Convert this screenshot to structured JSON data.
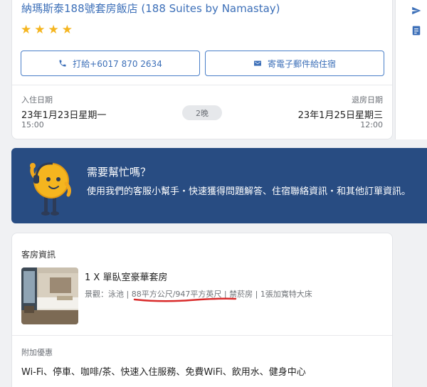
{
  "hotel": {
    "name": "納瑪斯泰188號套房飯店 (188 Suites by Namastay)",
    "star_count": 4,
    "stars": [
      "★",
      "★",
      "★",
      "★"
    ],
    "call_label": "打給+6017 870 2634",
    "email_label": "寄電子郵件給住宿",
    "checkin_label": "入住日期",
    "checkin_date": "23年1月23日星期一",
    "checkin_time": "15:00",
    "nights": "2晚",
    "checkout_label": "退房日期",
    "checkout_date": "23年1月25日星期三",
    "checkout_time": "12:00"
  },
  "help": {
    "title": "需要幫忙嗎？",
    "text": "使用我們的客服小幫手・快速獲得問題解答、住宿聯絡資訊・和其他訂單資訊。"
  },
  "room": {
    "section_title": "客房資訊",
    "type": "1 X 單臥室豪華套房",
    "meta_view": "景觀：",
    "meta_pool": "泳池",
    "meta_size": "88平方公尺/947平方英尺",
    "meta_smoking": "禁菸房",
    "meta_bed": "1張加寬特大床",
    "perks_title": "附加優惠",
    "perks_text": "Wi-Fi、停車、咖啡/茶、快速入住服務、免費WiFi、飲用水、健身中心"
  },
  "icons": {
    "call": "phone-icon",
    "email": "mail-icon",
    "side_1": "send-icon",
    "side_2": "receipt-icon",
    "star": "star-icon",
    "mascot": "assistant-mascot-icon"
  },
  "colors": {
    "accent": "#3c6fb8",
    "banner": "#284c82",
    "star": "#f5b51f",
    "annotation": "#d92b2b"
  }
}
